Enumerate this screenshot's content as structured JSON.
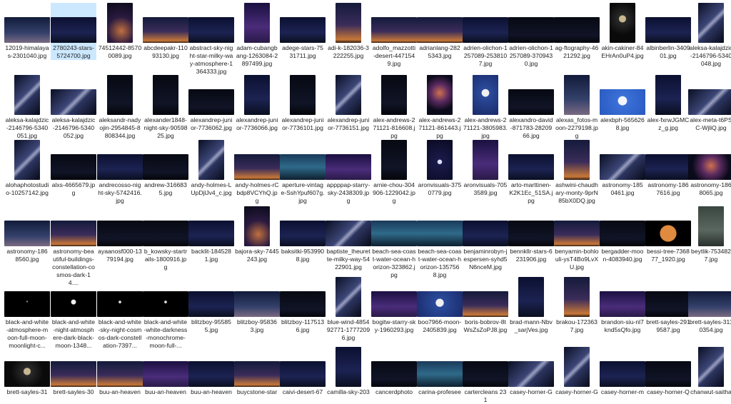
{
  "explorer": {
    "selected_index": 1,
    "items": [
      {
        "name": "12019-himalayas-2301040.jpg",
        "orient": "land",
        "tone": "dusk"
      },
      {
        "name": "2780243-stars-5724700.jpg",
        "orient": "land",
        "tone": "night"
      },
      {
        "name": "74512442-85700089.jpg",
        "orient": "port",
        "tone": "glow"
      },
      {
        "name": "abcdeepakr-11093130.jpg",
        "orient": "land",
        "tone": "sunset"
      },
      {
        "name": "abstract-sky-night-star-milky-way-atmosphere-1364333.jpg",
        "orient": "land",
        "tone": "night"
      },
      {
        "name": "adam-cubangbang-1263084-2897499.jpg",
        "orient": "port",
        "tone": "purple"
      },
      {
        "name": "adege-stars-7531711.jpg",
        "orient": "land",
        "tone": "night"
      },
      {
        "name": "adi-k-182036-3222255.jpg",
        "orient": "port",
        "tone": "sunset"
      },
      {
        "name": "adolfo_mazzotti-desert-4471549.jpg",
        "orient": "land",
        "tone": "sunset"
      },
      {
        "name": "adrianlang-2825343.jpg",
        "orient": "land",
        "tone": "sunset"
      },
      {
        "name": "adrien-olichon-1257089-2538107.jpg",
        "orient": "land",
        "tone": "night"
      },
      {
        "name": "adrien-olichon-1257089-3709430.jpg",
        "orient": "land",
        "tone": "dark"
      },
      {
        "name": "ag-ftography-4621292.jpg",
        "orient": "land",
        "tone": "dark"
      },
      {
        "name": "akin-cakiner-84EHrAn0uP4.jpg",
        "orient": "port",
        "tone": "moon"
      },
      {
        "name": "albinberlin-340901.jpg",
        "orient": "land",
        "tone": "night"
      },
      {
        "name": "aleksa-kalajdzic-2146796-5340048.jpg",
        "orient": "port",
        "tone": "milky"
      },
      {
        "name": "aleksa-kalajdzic-2146796-5340051.jpg",
        "orient": "port",
        "tone": "milky"
      },
      {
        "name": "aleksa-kalajdzic-2146796-5340052.jpg",
        "orient": "land",
        "tone": "milky"
      },
      {
        "name": "aleksandr-nadyojin-2954845-8808344.jpg",
        "orient": "port",
        "tone": "dark"
      },
      {
        "name": "alexander1848-night-sky-9059825.jpg",
        "orient": "port",
        "tone": "dark"
      },
      {
        "name": "alexandrep-junior-7736062.jpg",
        "orient": "land",
        "tone": "dark"
      },
      {
        "name": "alexandrep-junior-7736066.jpg",
        "orient": "port",
        "tone": "night"
      },
      {
        "name": "alexandrep-junior-7736101.jpg",
        "orient": "port",
        "tone": "dark"
      },
      {
        "name": "alexandrep-junior-7736151.jpg",
        "orient": "port",
        "tone": "milky"
      },
      {
        "name": "alex-andrews-271121-816608.jpg",
        "orient": "port",
        "tone": "dark"
      },
      {
        "name": "alex-andrews-271121-861443.jpg",
        "orient": "port",
        "tone": "nebula"
      },
      {
        "name": "alex-andrews-271121-3805983.jpg",
        "orient": "port",
        "tone": "moonblue"
      },
      {
        "name": "alexandro-david-871783-2820966.jpg",
        "orient": "land",
        "tone": "dark"
      },
      {
        "name": "alexas_fotos-moon-2279198.jpg",
        "orient": "port",
        "tone": "dusk"
      },
      {
        "name": "alexbph-5656268.jpg",
        "orient": "land",
        "tone": "bluesky"
      },
      {
        "name": "alex-fxrwJGMCz_g.jpg",
        "orient": "port",
        "tone": "night"
      },
      {
        "name": "alex-meta-t6PSC-WjliQ.jpg",
        "orient": "land",
        "tone": "milky"
      },
      {
        "name": "alohaphotostudio-10257142.jpg",
        "orient": "port",
        "tone": "milky"
      },
      {
        "name": "alxs-4665679.jpg",
        "orient": "land",
        "tone": "dark"
      },
      {
        "name": "andrecosso-night-sky-5742416.jpg",
        "orient": "land",
        "tone": "night"
      },
      {
        "name": "andrew-3166835.jpg",
        "orient": "land",
        "tone": "dark"
      },
      {
        "name": "andy-holmes-LUpDjlJv4_c.jpg",
        "orient": "port",
        "tone": "milky"
      },
      {
        "name": "andy-holmes-rCbdp8VCYhQ.jpg",
        "orient": "land",
        "tone": "sunset"
      },
      {
        "name": "aperture-vintage-SshYpuf607g.jpg",
        "orient": "land",
        "tone": "teal"
      },
      {
        "name": "appppap-starry-sky-2438309.jpg",
        "orient": "land",
        "tone": "purple"
      },
      {
        "name": "arnie-chou-304906-1229042.jpg",
        "orient": "port",
        "tone": "dark"
      },
      {
        "name": "aronvisuals-3750779.jpg",
        "orient": "port",
        "tone": "stars"
      },
      {
        "name": "aronvisuals-7053589.jpg",
        "orient": "port",
        "tone": "purple"
      },
      {
        "name": "arto-marttinen-K2K1Ec_51SA.jpg",
        "orient": "land",
        "tone": "night"
      },
      {
        "name": "ashwini-chaudhary-monty-9prN85bX0DQ.jpg",
        "orient": "port",
        "tone": "sunset"
      },
      {
        "name": "astronomy-1850461.jpg",
        "orient": "land",
        "tone": "milky"
      },
      {
        "name": "astronomy-1867616.jpg",
        "orient": "land",
        "tone": "night"
      },
      {
        "name": "astronomy-1868065.jpg",
        "orient": "land",
        "tone": "nebula"
      },
      {
        "name": "astronomy-1868560.jpg",
        "orient": "land",
        "tone": "dusk"
      },
      {
        "name": "astronomy-beautiful-buildings-constellation-cosmos-dark-14....",
        "orient": "land",
        "tone": "sunset"
      },
      {
        "name": "ayaanosf000-1379194.jpg",
        "orient": "land",
        "tone": "dark"
      },
      {
        "name": "b_kowsky-startrails-1800916.jpg",
        "orient": "land",
        "tone": "dark"
      },
      {
        "name": "backlit-1845281.jpg",
        "orient": "land",
        "tone": "night"
      },
      {
        "name": "bajora-sky-7445243.jpg",
        "orient": "port",
        "tone": "glow"
      },
      {
        "name": "baksitki-9539908.jpg",
        "orient": "land",
        "tone": "night"
      },
      {
        "name": "baptiste_lheurette-milky-way-5422901.jpg",
        "orient": "land",
        "tone": "milky"
      },
      {
        "name": "beach-sea-coast-water-ocean-horizon-323862.jpg",
        "orient": "land",
        "tone": "teal"
      },
      {
        "name": "beach-sea-coast-water-ocean-horizon-1357568.jpg",
        "orient": "land",
        "tone": "teal"
      },
      {
        "name": "benjaminrobyn-jespersen-syhd5N6nceM.jpg",
        "orient": "land",
        "tone": "night"
      },
      {
        "name": "bennkllr-stars-6231906.jpg",
        "orient": "land",
        "tone": "dark"
      },
      {
        "name": "benyamin-bohlouli-ysT4Bo9LvXU.jpg",
        "orient": "land",
        "tone": "sunset"
      },
      {
        "name": "bergadder-moon-4083940.jpg",
        "orient": "land",
        "tone": "dark"
      },
      {
        "name": "bessi-tree-736877_1920.jpg",
        "orient": "land",
        "tone": "orangemoon"
      },
      {
        "name": "beytlik-7534827.jpg",
        "orient": "port",
        "tone": "grey"
      },
      {
        "name": "black-and-white-atmosphere-moon-full-moon-moonlight-c...",
        "orient": "land",
        "tone": "black"
      },
      {
        "name": "black-and-white-night-atmosphere-dark-black-moon-1348...",
        "orient": "land",
        "tone": "blackmoon"
      },
      {
        "name": "black-and-white-sky-night-cosmos-dark-constellation-7397...",
        "orient": "land",
        "tone": "blackdot"
      },
      {
        "name": "black-and-white-white-darkness-monochrome-moon-full-...",
        "orient": "land",
        "tone": "blackdot"
      },
      {
        "name": "blitzboy-955855.jpg",
        "orient": "land",
        "tone": "night"
      },
      {
        "name": "blitzboy-958363.jpg",
        "orient": "land",
        "tone": "dusk"
      },
      {
        "name": "blitzboy-1175136.jpg",
        "orient": "land",
        "tone": "dark"
      },
      {
        "name": "blue-wind-485492771-17772096.jpg",
        "orient": "port",
        "tone": "milky"
      },
      {
        "name": "bogitw-starry-sky-1960293.jpg",
        "orient": "land",
        "tone": "purple"
      },
      {
        "name": "boo7966-moon-2405839.jpg",
        "orient": "land",
        "tone": "moonblue"
      },
      {
        "name": "boris-bobrov-8tWsZsZoPJ8.jpg",
        "orient": "land",
        "tone": "sunset"
      },
      {
        "name": "brad-mann-Nbv_sarjVes.jpg",
        "orient": "port",
        "tone": "night"
      },
      {
        "name": "brakou-1723637.jpg",
        "orient": "port",
        "tone": "sunset"
      },
      {
        "name": "brandon-siu-nl7knd5sQfo.jpg",
        "orient": "land",
        "tone": "purple"
      },
      {
        "name": "brett-sayles-2919587.jpg",
        "orient": "land",
        "tone": "dark"
      },
      {
        "name": "brett-sayles-3110354.jpg",
        "orient": "land",
        "tone": "dusk"
      },
      {
        "name": "brett-sayles-31",
        "orient": "land",
        "tone": "moon"
      },
      {
        "name": "brett-sayles-30",
        "orient": "land",
        "tone": "sunset"
      },
      {
        "name": "buu-an-heaven",
        "orient": "land",
        "tone": "sunset"
      },
      {
        "name": "buu-an-heaven",
        "orient": "land",
        "tone": "purple"
      },
      {
        "name": "buu-an-heaven",
        "orient": "land",
        "tone": "night"
      },
      {
        "name": "buycstone-star",
        "orient": "land",
        "tone": "sunset"
      },
      {
        "name": "caivi-desert-67",
        "orient": "land",
        "tone": "night"
      },
      {
        "name": "camilla-sky-203",
        "orient": "port",
        "tone": "night"
      },
      {
        "name": "cancerdphoto",
        "orient": "land",
        "tone": "dark"
      },
      {
        "name": "carina-profesee",
        "orient": "land",
        "tone": "teal"
      },
      {
        "name": "cartercleans 23 1",
        "orient": "land",
        "tone": "dark"
      },
      {
        "name": "casey-horner-G",
        "orient": "land",
        "tone": "milky"
      },
      {
        "name": "casey-horner-G",
        "orient": "port",
        "tone": "milky"
      },
      {
        "name": "casey-horner-m",
        "orient": "land",
        "tone": "night"
      },
      {
        "name": "casey-horner-Q",
        "orient": "land",
        "tone": "dark"
      },
      {
        "name": "chanwut-saitha",
        "orient": "port",
        "tone": "milky"
      }
    ]
  }
}
